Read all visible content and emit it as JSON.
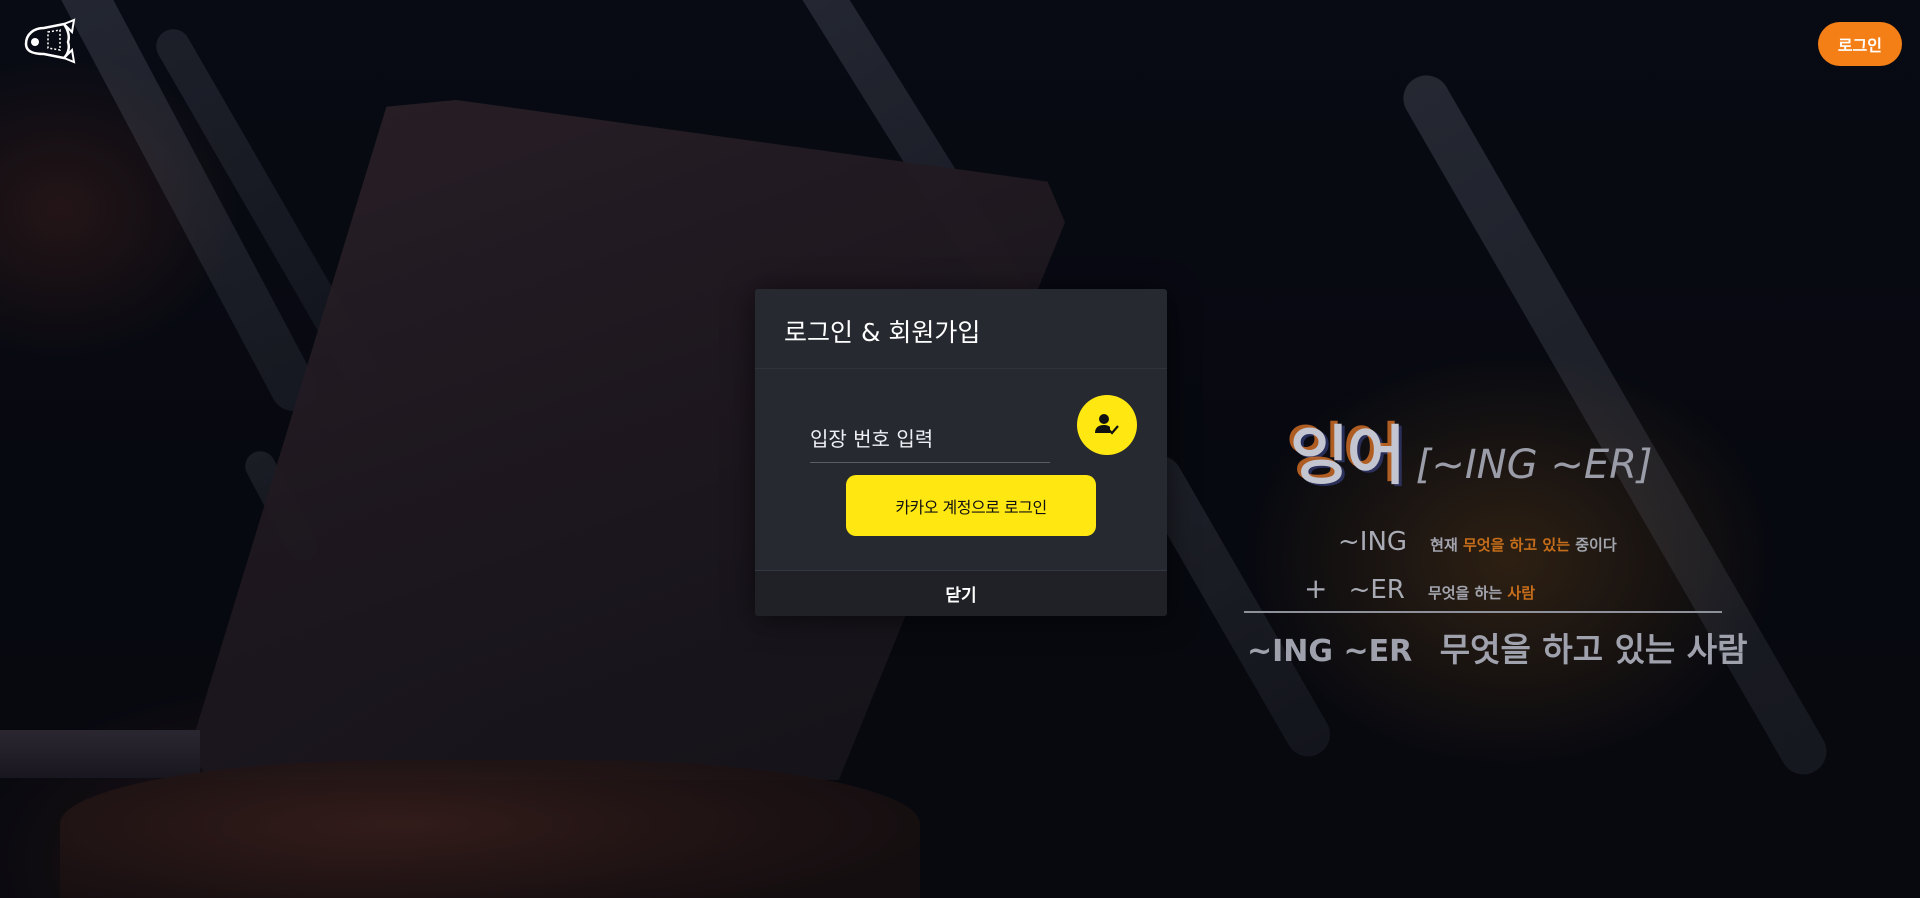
{
  "header": {
    "login_label": "로그인"
  },
  "hero": {
    "title": "잉어",
    "subtitle": "[~ING ~ER]",
    "row1": {
      "term": "~ING",
      "desc_pre": "현재 ",
      "desc_highlight": "무엇을 하고 있는",
      "desc_post": " 중이다"
    },
    "row2": {
      "plus": "+",
      "term": "~ER",
      "desc_pre": "무엇을 하는 ",
      "desc_highlight": "사람"
    },
    "summary": {
      "term": "~ING ~ER",
      "desc": "무엇을 하고 있는 사람"
    }
  },
  "modal": {
    "title": "로그인 & 회원가입",
    "code_placeholder": "입장 번호 입력",
    "code_value": "",
    "kakao_label": "카카오 계정으로 로그인",
    "close_label": "닫기"
  },
  "colors": {
    "accent_orange": "#f57f17",
    "kakao_yellow": "#ffe812",
    "modal_bg": "#262930",
    "highlight": "#c56d1a"
  },
  "icons": {
    "logo": "fish-logo-icon",
    "enter": "person-check-icon"
  }
}
